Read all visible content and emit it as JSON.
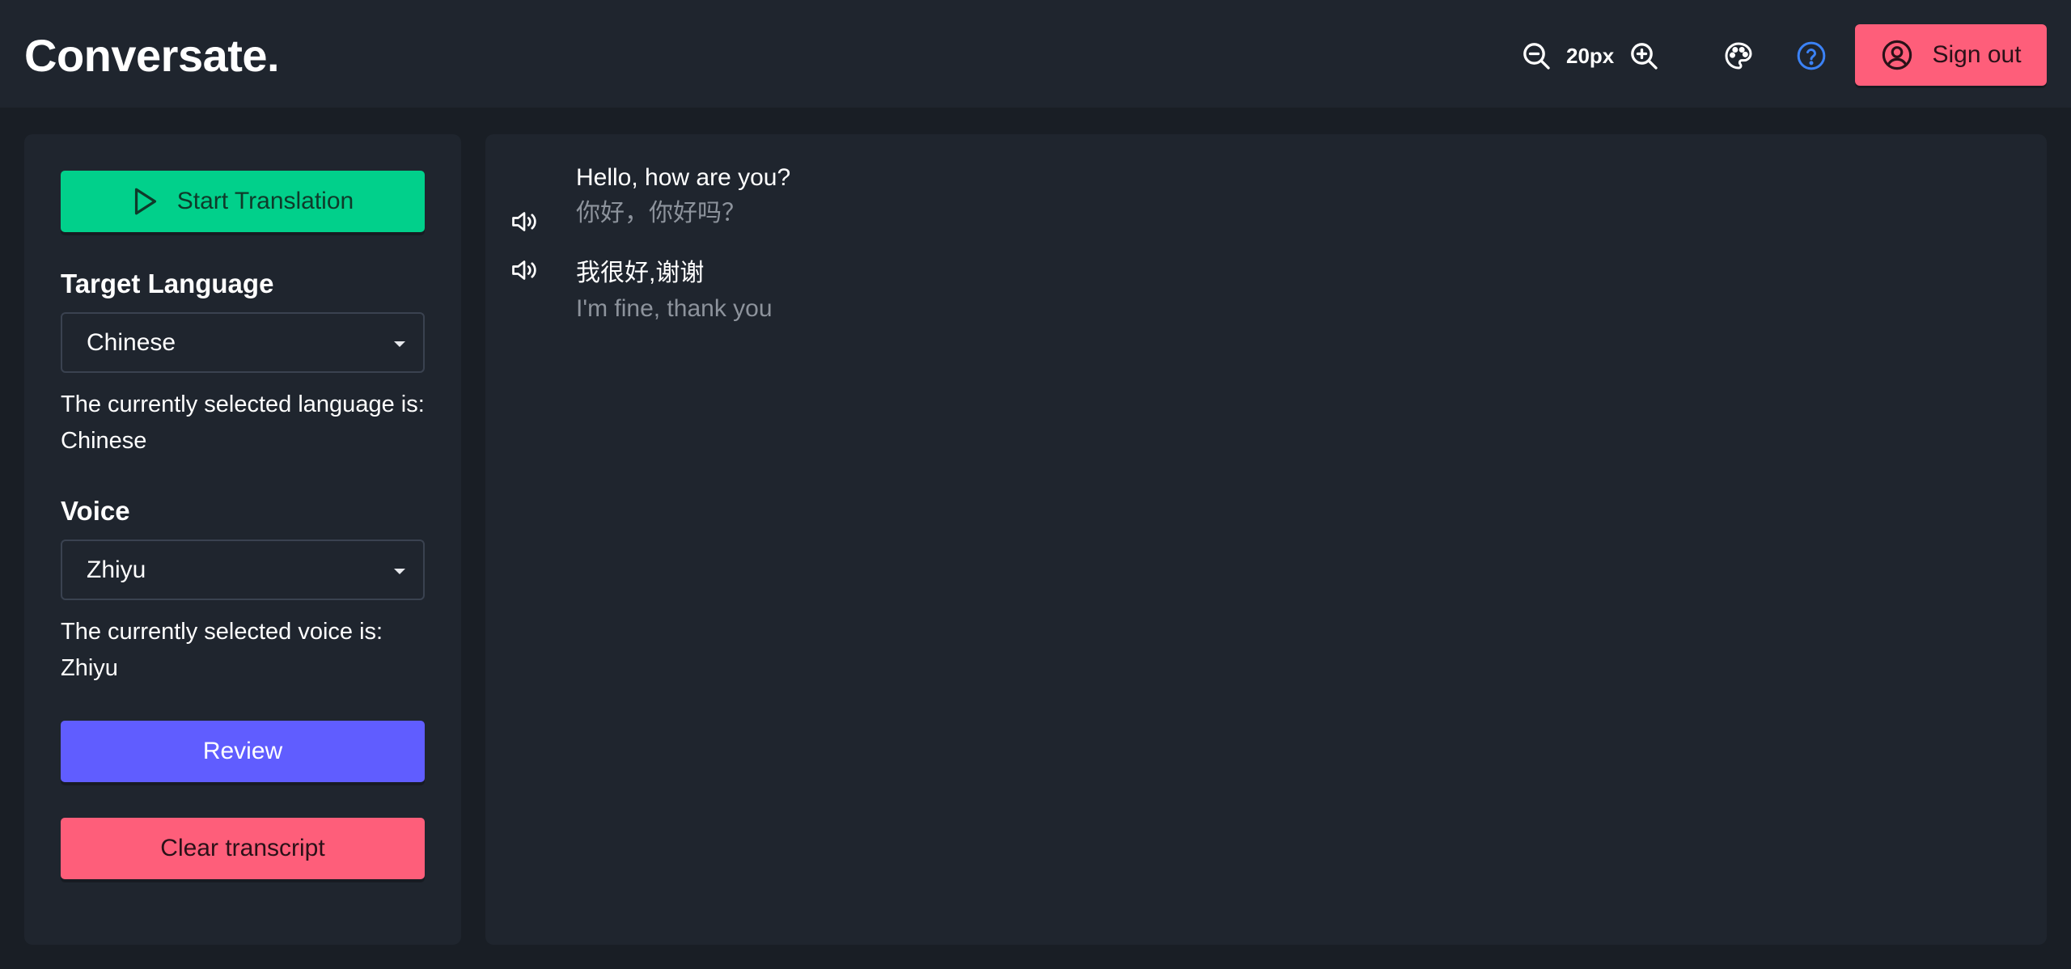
{
  "header": {
    "brand": "Conversate.",
    "zoom_level": "20px",
    "signout_label": "Sign out"
  },
  "sidebar": {
    "start_label": "Start Translation",
    "language_title": "Target Language",
    "language_value": "Chinese",
    "language_note": "The currently selected language is: Chinese",
    "voice_title": "Voice",
    "voice_value": "Zhiyu",
    "voice_note": "The currently selected voice is: Zhiyu",
    "review_label": "Review",
    "clear_label": "Clear transcript"
  },
  "transcript": [
    {
      "original": "Hello, how are you?",
      "translation": "你好，你好吗？"
    },
    {
      "original": "我很好,谢谢",
      "translation": "I'm fine, thank you"
    }
  ],
  "colors": {
    "background": "#191e25",
    "panel": "#1f252e",
    "start_green": "#01d08b",
    "review_purple": "#605dff",
    "danger_pink": "#fe5e7a",
    "help_blue": "#3b82f6"
  }
}
